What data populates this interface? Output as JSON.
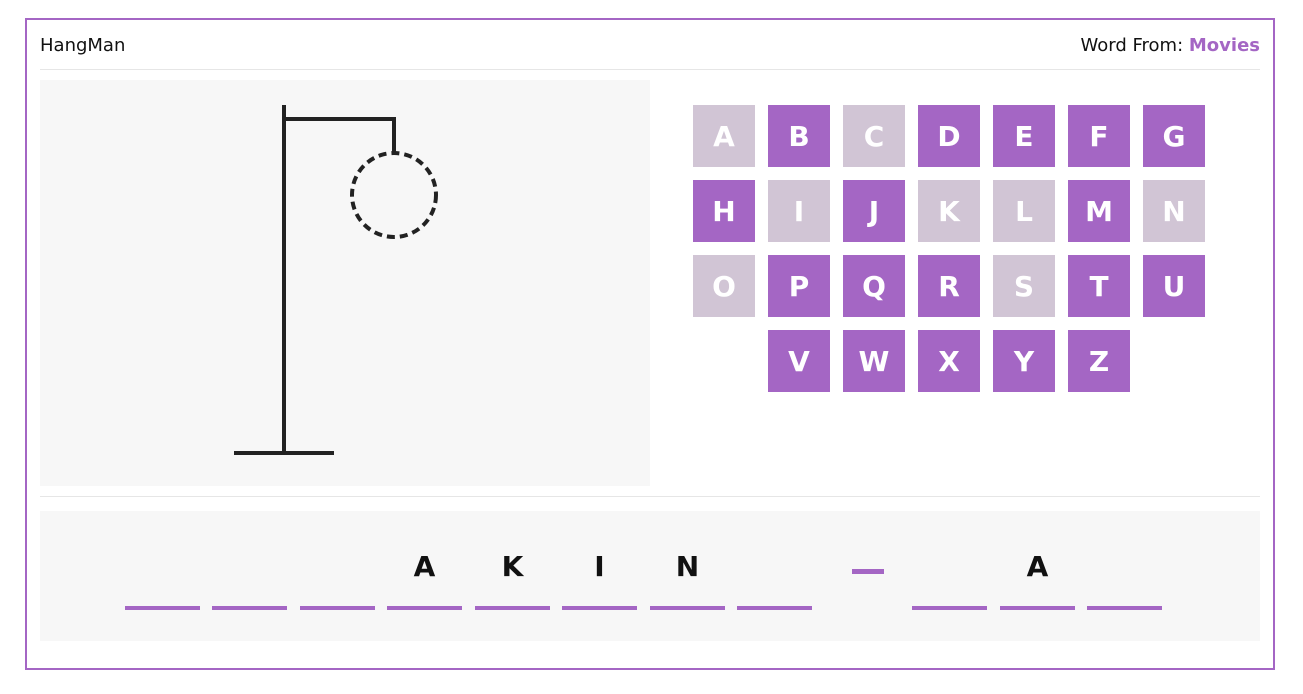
{
  "header": {
    "title": "HangMan",
    "word_from_label": "Word From:",
    "category": "Movies"
  },
  "colors": {
    "accent": "#a466c4",
    "used_key": "#d1c5d5",
    "panel": "#f7f7f7",
    "ink": "#222222"
  },
  "keyboard": {
    "keys": [
      {
        "letter": "A",
        "state": "used"
      },
      {
        "letter": "B",
        "state": "active"
      },
      {
        "letter": "C",
        "state": "used"
      },
      {
        "letter": "D",
        "state": "active"
      },
      {
        "letter": "E",
        "state": "active"
      },
      {
        "letter": "F",
        "state": "active"
      },
      {
        "letter": "G",
        "state": "active"
      },
      {
        "letter": "H",
        "state": "active"
      },
      {
        "letter": "I",
        "state": "used"
      },
      {
        "letter": "J",
        "state": "active"
      },
      {
        "letter": "K",
        "state": "used"
      },
      {
        "letter": "L",
        "state": "used"
      },
      {
        "letter": "M",
        "state": "active"
      },
      {
        "letter": "N",
        "state": "used"
      },
      {
        "letter": "O",
        "state": "used"
      },
      {
        "letter": "P",
        "state": "active"
      },
      {
        "letter": "Q",
        "state": "active"
      },
      {
        "letter": "R",
        "state": "active"
      },
      {
        "letter": "S",
        "state": "used"
      },
      {
        "letter": "T",
        "state": "active"
      },
      {
        "letter": "U",
        "state": "active"
      },
      {
        "letter": "V",
        "state": "active"
      },
      {
        "letter": "W",
        "state": "active"
      },
      {
        "letter": "X",
        "state": "active"
      },
      {
        "letter": "Y",
        "state": "active"
      },
      {
        "letter": "Z",
        "state": "active"
      }
    ]
  },
  "word": {
    "slots": [
      {
        "type": "letter",
        "char": ""
      },
      {
        "type": "letter",
        "char": ""
      },
      {
        "type": "letter",
        "char": ""
      },
      {
        "type": "letter",
        "char": "A"
      },
      {
        "type": "letter",
        "char": "K"
      },
      {
        "type": "letter",
        "char": "I"
      },
      {
        "type": "letter",
        "char": "N"
      },
      {
        "type": "letter",
        "char": ""
      },
      {
        "type": "dash",
        "char": ""
      },
      {
        "type": "letter",
        "char": ""
      },
      {
        "type": "letter",
        "char": "A"
      },
      {
        "type": "letter",
        "char": ""
      }
    ]
  },
  "hangman": {
    "parts_shown": [
      "gallows",
      "head-outline"
    ]
  }
}
